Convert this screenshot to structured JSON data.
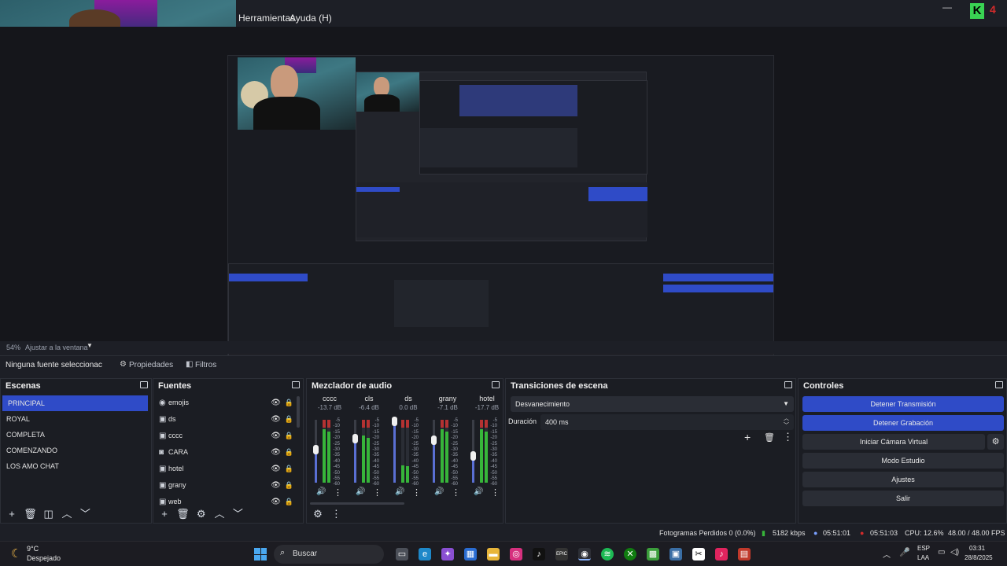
{
  "menubar": {
    "tools_label": "Herramientas",
    "help_label": "Ayuda (H)"
  },
  "preview": {
    "scale_label": "54%",
    "scale_mode": "Ajustar a la ventana"
  },
  "source_toolbar": {
    "no_source": "Ninguna fuente seleccionac",
    "properties_label": "Propiedades",
    "filters_label": "Filtros"
  },
  "scenes": {
    "title": "Escenas",
    "items": [
      {
        "label": "PRINCIPAL",
        "selected": true
      },
      {
        "label": "ROYAL",
        "selected": false
      },
      {
        "label": "COMPLETA",
        "selected": false
      },
      {
        "label": "COMENZANDO",
        "selected": false
      },
      {
        "label": "LOS AMO CHAT",
        "selected": false
      }
    ]
  },
  "sources": {
    "title": "Fuentes",
    "items": [
      {
        "label": "emojis",
        "icon": "globe-icon"
      },
      {
        "label": "ds",
        "icon": "window-icon"
      },
      {
        "label": "cccc",
        "icon": "window-icon"
      },
      {
        "label": "CARA",
        "icon": "camera-icon"
      },
      {
        "label": "hotel",
        "icon": "window-icon"
      },
      {
        "label": "grany",
        "icon": "window-icon"
      },
      {
        "label": "web",
        "icon": "window-icon"
      }
    ]
  },
  "mixer": {
    "title": "Mezclador de audio",
    "scale": [
      "-5",
      "-10",
      "-15",
      "-20",
      "-25",
      "-30",
      "-35",
      "-40",
      "-45",
      "-50",
      "-55",
      "-60"
    ],
    "channels": [
      {
        "name": "cccc",
        "db": "-13.7 dB",
        "fader_level": 0.55,
        "meter_level": 0.85
      },
      {
        "name": "cls",
        "db": "-6.4 dB",
        "fader_level": 0.72,
        "meter_level": 0.75
      },
      {
        "name": "ds",
        "db": "0.0 dB",
        "fader_level": 1.0,
        "meter_level": 0.28
      },
      {
        "name": "grany",
        "db": "-7.1 dB",
        "fader_level": 0.7,
        "meter_level": 0.85
      },
      {
        "name": "hotel",
        "db": "-17.7 dB",
        "fader_level": 0.45,
        "meter_level": 0.85
      }
    ]
  },
  "transitions": {
    "title": "Transiciones de escena",
    "selected": "Desvanecimiento",
    "duration_label": "Duración",
    "duration_value": "400 ms"
  },
  "controls": {
    "title": "Controles",
    "stop_stream": "Detener Transmisión",
    "stop_record": "Detener Grabación",
    "virtual_cam": "Iniciar Cámara Virtual",
    "studio_mode": "Modo Estudio",
    "settings": "Ajustes",
    "exit": "Salir"
  },
  "status": {
    "dropped": "Fotogramas Perdidos 0 (0.0%)",
    "bitrate": "5182 kbps",
    "stream_time": "05:51:01",
    "rec_time": "05:51:03",
    "cpu": "CPU: 12.6%",
    "fps": "48.00 / 48.00 FPS"
  },
  "taskbar": {
    "weather_temp": "9°C",
    "weather_desc": "Despejado",
    "search_label": "Buscar",
    "lang": "ESP",
    "lang_region": "LAA",
    "time": "03:31",
    "date": "28/8/2025"
  },
  "colors": {
    "accent": "#2f4bc7",
    "meter_green": "#37b53a",
    "meter_red": "#b53232",
    "rec_red": "#d22b2b"
  }
}
